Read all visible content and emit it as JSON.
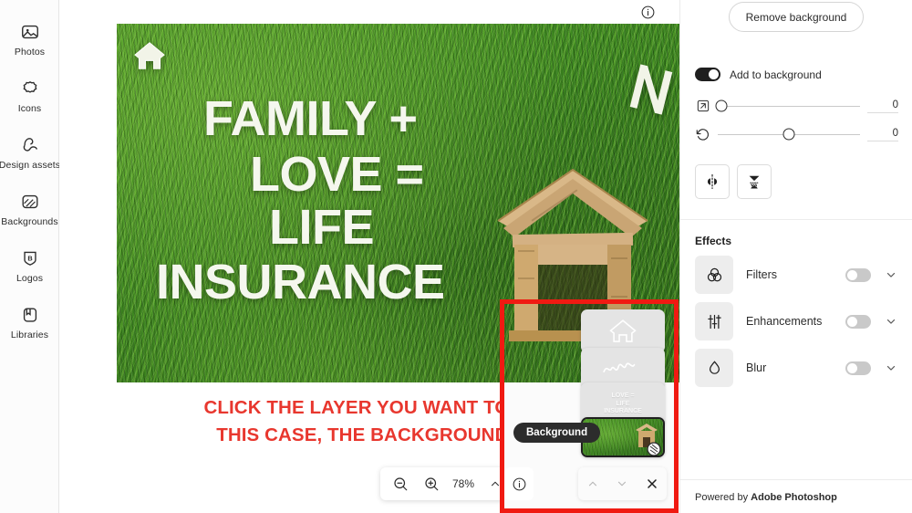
{
  "sidebar": {
    "items": [
      {
        "label": "Photos",
        "icon": "photos-icon"
      },
      {
        "label": "Icons",
        "icon": "icons-icon"
      },
      {
        "label": "Design assets",
        "icon": "design-assets-icon"
      },
      {
        "label": "Backgrounds",
        "icon": "backgrounds-icon"
      },
      {
        "label": "Logos",
        "icon": "logos-icon"
      },
      {
        "label": "Libraries",
        "icon": "libraries-icon"
      }
    ]
  },
  "canvas": {
    "artwork": {
      "line1": "FAMILY +",
      "line2": "LOVE =",
      "line3": "LIFE",
      "line4": "INSURANCE",
      "house_glyph": "house-icon",
      "n_glyph": "letter-n-glyph"
    },
    "info_icon": "info-icon",
    "caption_line1": "CLICK THE LAYER YOU WANT TO EDIT - IN",
    "caption_line2": "THIS CASE, THE BACKGROUND IMAGE.",
    "caption_color": "#e8372e"
  },
  "zoom_toolbar": {
    "zoom_out_icon": "zoom-out-icon",
    "zoom_in_icon": "zoom-in-icon",
    "zoom_level": "78%",
    "chevron_up_icon": "chevron-up-icon",
    "info_icon": "info-icon"
  },
  "layers": {
    "highlight_color": "#f01a12",
    "selected_label": "Background",
    "thumbnails": [
      {
        "name": "house-logo-layer",
        "text": ""
      },
      {
        "name": "signature-layer",
        "text": ""
      },
      {
        "name": "headline-text-layer",
        "text": "LOVE =\nLIFE\nINSURANCE"
      },
      {
        "name": "background-image-layer",
        "text": ""
      }
    ],
    "info_icon": "info-icon",
    "move_up_icon": "chevron-up-icon",
    "move_down_icon": "chevron-down-icon",
    "close_icon": "close-icon"
  },
  "right_panel": {
    "remove_background_label": "Remove background",
    "add_to_background": {
      "label": "Add to background",
      "state": "on"
    },
    "sliders": [
      {
        "icon": "resize-icon",
        "value": "0",
        "knob_pct": 0
      },
      {
        "icon": "rotate-icon",
        "value": "0",
        "knob_pct": 50
      }
    ],
    "tool_buttons": [
      {
        "name": "flip-horizontal-button",
        "icon": "flip-horizontal-icon"
      },
      {
        "name": "shadow-button",
        "icon": "shadow-icon"
      }
    ],
    "effects": {
      "title": "Effects",
      "items": [
        {
          "label": "Filters",
          "icon": "filters-icon",
          "state": "off"
        },
        {
          "label": "Enhancements",
          "icon": "enhancements-icon",
          "state": "off"
        },
        {
          "label": "Blur",
          "icon": "blur-icon",
          "state": "off"
        }
      ]
    },
    "footer_prefix": "Powered by ",
    "footer_brand": "Adobe Photoshop"
  }
}
